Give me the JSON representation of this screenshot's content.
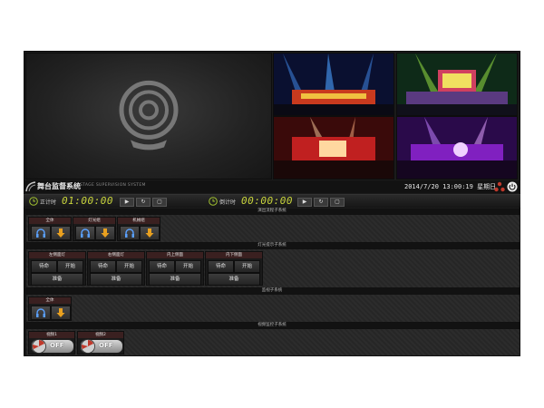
{
  "app": {
    "title": "舞台监督系统",
    "subtitle": "STAGE SUPERVISION SYSTEM",
    "datetime": "2014/7/20 13:00:19 星期日"
  },
  "timers": {
    "countup": {
      "label": "正计时",
      "value": "01:00:00"
    },
    "countdown": {
      "label": "倒计时",
      "value": "00:00:00"
    },
    "controls": [
      "▶",
      "↻",
      "▢"
    ]
  },
  "sections": {
    "s1": {
      "title": "演出流程子系统",
      "groups": [
        {
          "title": "全体"
        },
        {
          "title": "灯光组"
        },
        {
          "title": "机械组"
        }
      ]
    },
    "s2": {
      "title": "灯光提示子系统",
      "groups": [
        {
          "title": "左侧面灯",
          "btn1": "待命",
          "btn2": "开始",
          "btn3": "准备"
        },
        {
          "title": "右侧面灯",
          "btn1": "待命",
          "btn2": "开始",
          "btn3": "准备"
        },
        {
          "title": "内上侧面",
          "btn1": "待命",
          "btn2": "开始",
          "btn3": "准备"
        },
        {
          "title": "内下侧面",
          "btn1": "待命",
          "btn2": "开始",
          "btn3": "准备"
        }
      ]
    },
    "s3": {
      "title": "监视子系统",
      "groups": [
        {
          "title": "全体"
        }
      ]
    },
    "s4": {
      "title": "视频监控子系统",
      "groups": [
        {
          "title": "视频1",
          "state": "OFF"
        },
        {
          "title": "视频2",
          "state": "OFF"
        }
      ]
    }
  },
  "colors": {
    "timer_digits": "#c8d43c",
    "group_header": "#3a2020",
    "panel_bg": "#1b1b1b"
  },
  "icons": {
    "main_video": "webcam-icon",
    "headset": "headset-icon",
    "download": "arrow-down-icon",
    "clock": "clock-icon",
    "settings": "network-icon",
    "power": "power-icon"
  }
}
